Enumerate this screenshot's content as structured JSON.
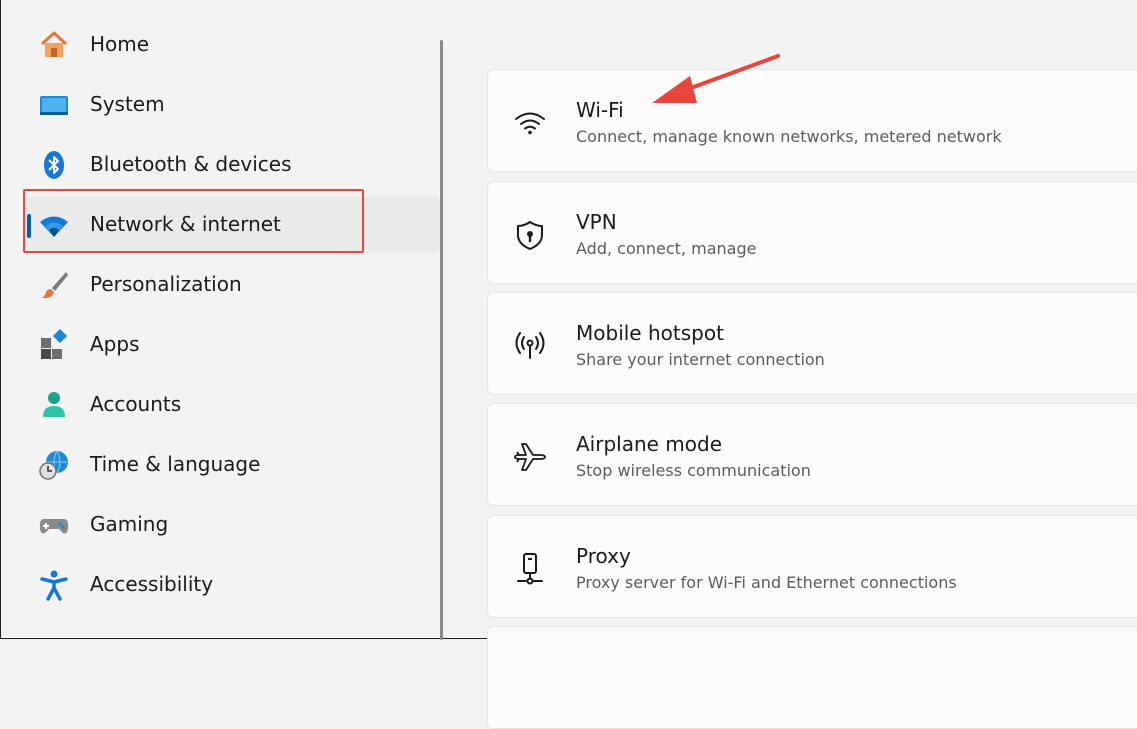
{
  "sidebar": {
    "items": [
      {
        "label": "Home",
        "icon": "home-icon"
      },
      {
        "label": "System",
        "icon": "monitor-icon"
      },
      {
        "label": "Bluetooth & devices",
        "icon": "bluetooth-icon"
      },
      {
        "label": "Network & internet",
        "icon": "wifi-icon",
        "selected": true
      },
      {
        "label": "Personalization",
        "icon": "paintbrush-icon"
      },
      {
        "label": "Apps",
        "icon": "apps-icon"
      },
      {
        "label": "Accounts",
        "icon": "person-icon"
      },
      {
        "label": "Time & language",
        "icon": "clock-globe-icon"
      },
      {
        "label": "Gaming",
        "icon": "gamepad-icon"
      },
      {
        "label": "Accessibility",
        "icon": "accessibility-icon"
      }
    ]
  },
  "main": {
    "cards": [
      {
        "title": "Wi-Fi",
        "description": "Connect, manage known networks, metered network",
        "icon": "wifi-signal-icon"
      },
      {
        "title": "VPN",
        "description": "Add, connect, manage",
        "icon": "shield-lock-icon"
      },
      {
        "title": "Mobile hotspot",
        "description": "Share your internet connection",
        "icon": "hotspot-icon"
      },
      {
        "title": "Airplane mode",
        "description": "Stop wireless communication",
        "icon": "airplane-icon"
      },
      {
        "title": "Proxy",
        "description": "Proxy server for Wi-Fi and Ethernet connections",
        "icon": "proxy-icon"
      }
    ]
  },
  "colors": {
    "accent": "#005fb8",
    "annotation": "#e8453c",
    "background": "#f3f3f3",
    "card": "#fbfbfb"
  }
}
